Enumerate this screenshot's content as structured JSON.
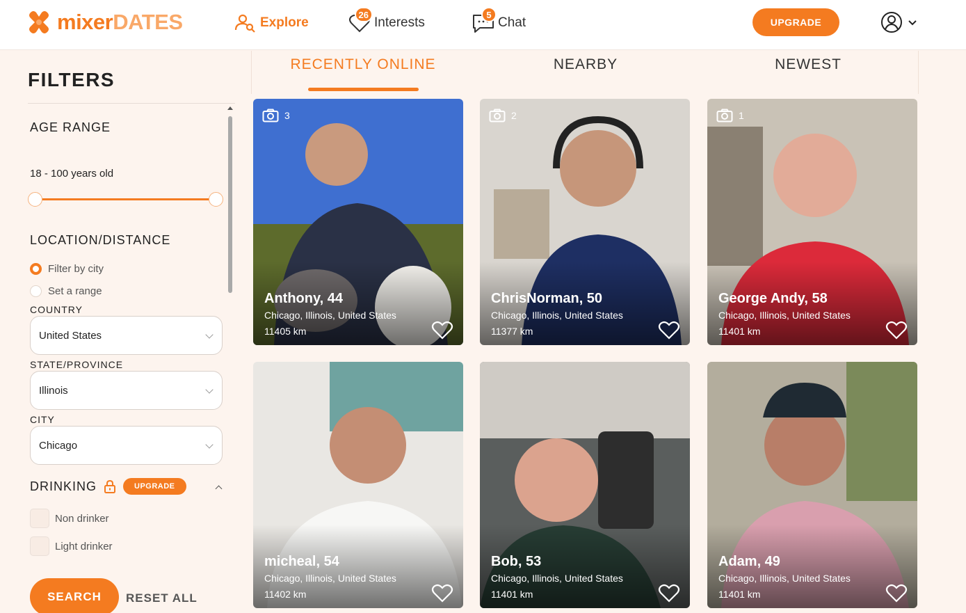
{
  "brand": {
    "name_part1": "mixer",
    "name_part2": "DATES",
    "accent_color": "#f47b20"
  },
  "nav": {
    "explore": "Explore",
    "interests": "Interests",
    "interests_badge": "26",
    "chat": "Chat",
    "chat_badge": "5",
    "upgrade": "UPGRADE"
  },
  "filters": {
    "title": "FILTERS",
    "age_range_title": "AGE RANGE",
    "age_value": "18 - 100 years old",
    "age_min": 18,
    "age_max": 100,
    "location_title": "LOCATION/DISTANCE",
    "filter_by_city": "Filter by city",
    "set_range": "Set a range",
    "country_label": "COUNTRY",
    "country_value": "United States",
    "state_label": "STATE/PROVINCE",
    "state_value": "Illinois",
    "city_label": "CITY",
    "city_value": "Chicago",
    "drinking_title": "DRINKING",
    "drinking_upgrade": "UPGRADE",
    "non_drinker": "Non drinker",
    "light_drinker": "Light drinker",
    "search": "SEARCH",
    "reset": "RESET ALL"
  },
  "tabs": [
    "RECENTLY ONLINE",
    "NEARBY",
    "NEWEST"
  ],
  "cards": [
    {
      "photos": "3",
      "name": "Anthony, 44",
      "location": "Chicago, Illinois, United States",
      "distance": "11405 km"
    },
    {
      "photos": "2",
      "name": "ChrisNorman, 50",
      "location": "Chicago, Illinois, United States",
      "distance": "11377 km"
    },
    {
      "photos": "1",
      "name": "George Andy, 58",
      "location": "Chicago, Illinois, United States",
      "distance": "11401 km"
    },
    {
      "photos": "",
      "name": "micheal, 54",
      "location": "Chicago, Illinois, United States",
      "distance": "11402 km"
    },
    {
      "photos": "",
      "name": "Bob, 53",
      "location": "Chicago, Illinois, United States",
      "distance": "11401 km"
    },
    {
      "photos": "",
      "name": "Adam, 49",
      "location": "Chicago, Illinois, United States",
      "distance": "11401 km"
    }
  ]
}
